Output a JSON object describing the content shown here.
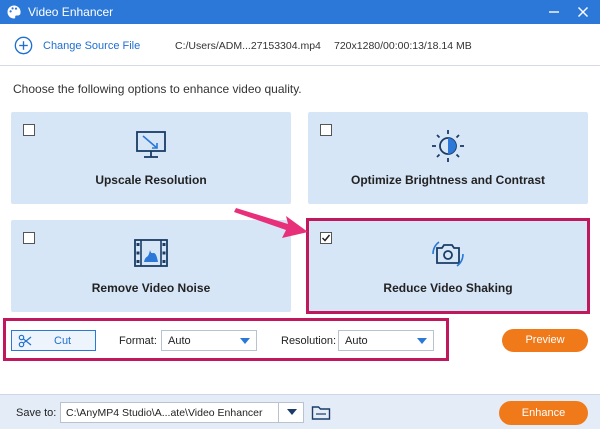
{
  "window": {
    "title": "Video Enhancer",
    "icon": "palette-icon",
    "accent": "#2b78d8"
  },
  "file": {
    "change_label": "Change Source File",
    "path": "C:/Users/ADM...27153304.mp4",
    "meta": "720x1280/00:00:13/18.14 MB"
  },
  "prompt": "Choose the following options to enhance video quality.",
  "options": [
    {
      "label": "Upscale Resolution",
      "icon": "monitor-resolution-icon",
      "checked": false
    },
    {
      "label": "Optimize Brightness and Contrast",
      "icon": "brightness-icon",
      "checked": false
    },
    {
      "label": "Remove Video Noise",
      "icon": "film-noise-icon",
      "checked": false
    },
    {
      "label": "Reduce Video Shaking",
      "icon": "stabilize-camera-icon",
      "checked": true
    }
  ],
  "controls": {
    "cut_label": "Cut",
    "format_label": "Format:",
    "format_value": "Auto",
    "resolution_label": "Resolution:",
    "resolution_value": "Auto",
    "preview_label": "Preview"
  },
  "footer": {
    "save_label": "Save to:",
    "save_path": "C:\\AnyMP4 Studio\\A...ate\\Video Enhancer",
    "enhance_label": "Enhance"
  },
  "colors": {
    "highlight": "#c0185c",
    "card_bg": "#d6e6f7",
    "button_orange": "#f07a1a",
    "link_blue": "#1e6fd0"
  }
}
